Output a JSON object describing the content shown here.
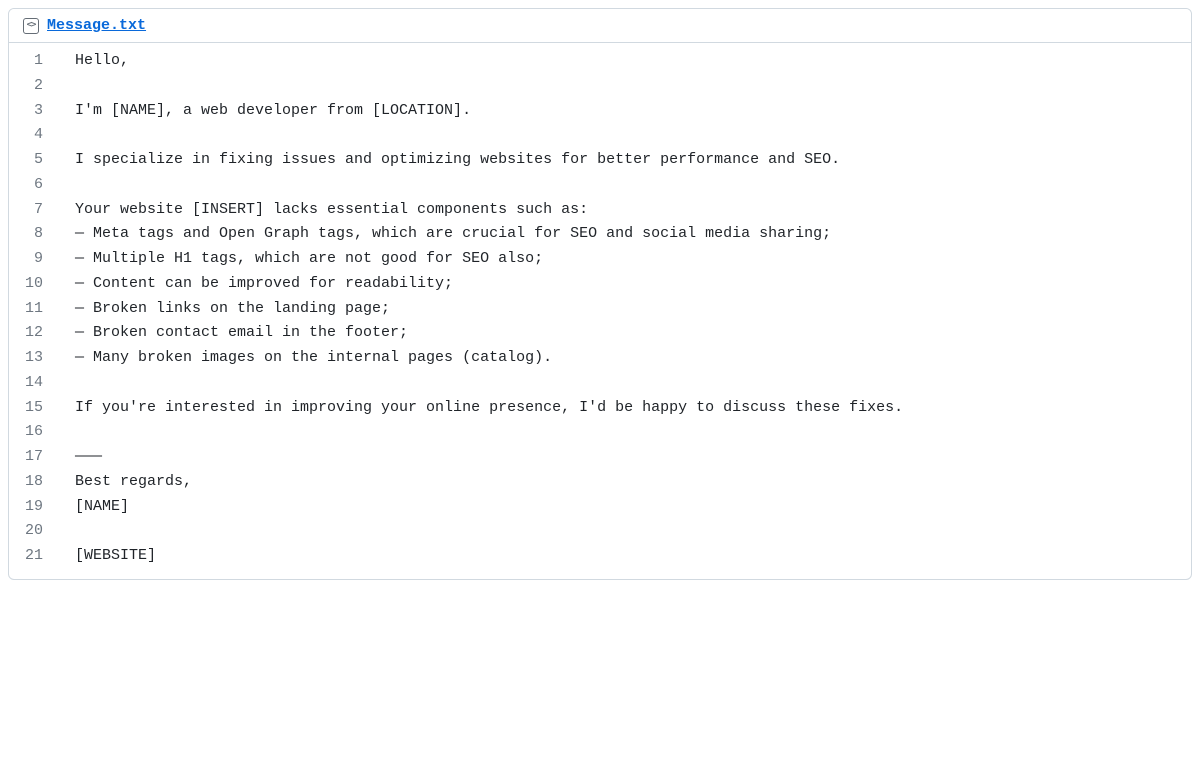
{
  "file": {
    "name": "Message.txt",
    "icon_label": "<>"
  },
  "lines": [
    "Hello,",
    "",
    "I'm [NAME], a web developer from [LOCATION].",
    "",
    "I specialize in fixing issues and optimizing websites for better performance and SEO.",
    "",
    "Your website [INSERT] lacks essential components such as:",
    "— Meta tags and Open Graph tags, which are crucial for SEO and social media sharing;",
    "— Multiple H1 tags, which are not good for SEO also;",
    "— Content can be improved for readability;",
    "— Broken links on the landing page;",
    "— Broken contact email in the footer;",
    "— Many broken images on the internal pages (catalog).",
    "",
    "If you're interested in improving your online presence, I'd be happy to discuss these fixes.",
    "",
    "———",
    "Best regards,",
    "[NAME]",
    "",
    "[WEBSITE]"
  ]
}
